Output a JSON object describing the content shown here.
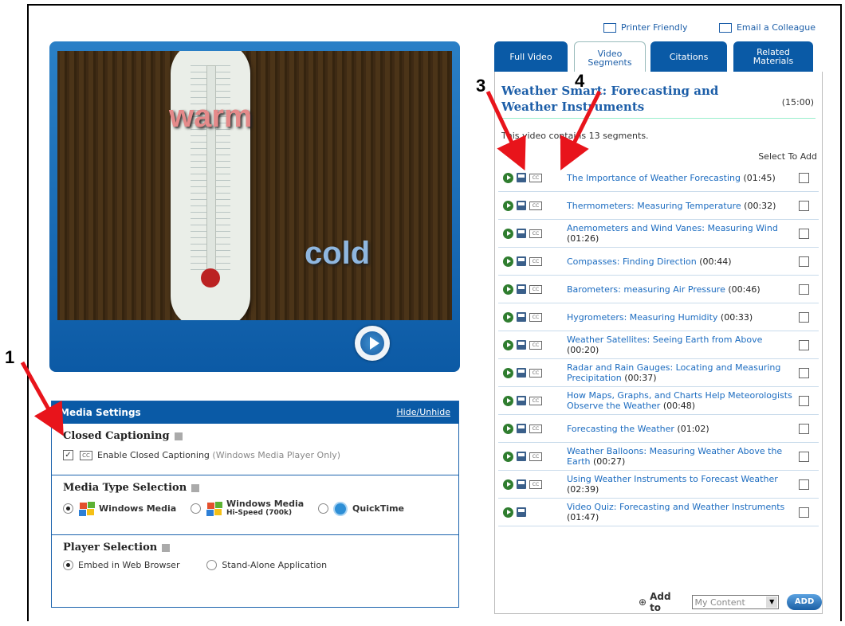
{
  "top_links": {
    "printer": "Printer Friendly",
    "email": "Email a Colleague"
  },
  "video_words": {
    "warm": "warm",
    "cold": "cold"
  },
  "media_settings": {
    "title": "Media Settings",
    "hide_link": "Hide/Unhide",
    "closed_captioning": {
      "title": "Closed Captioning",
      "option": "Enable Closed Captioning",
      "note": "(Windows Media Player Only)",
      "checked": true
    },
    "media_type": {
      "title": "Media Type Selection",
      "options": [
        {
          "label": "Windows Media",
          "selected": true
        },
        {
          "label": "Windows Media",
          "sub": "Hi-Speed (700k)",
          "selected": false
        },
        {
          "label": "QuickTime",
          "selected": false
        }
      ]
    },
    "player": {
      "title": "Player Selection",
      "options": [
        {
          "label": "Embed in Web Browser",
          "selected": true
        },
        {
          "label": "Stand-Alone Application",
          "selected": false
        }
      ]
    }
  },
  "tabs": [
    {
      "label": "Full Video",
      "active": false
    },
    {
      "label": "Video Segments",
      "active": true
    },
    {
      "label": "Citations",
      "active": false
    },
    {
      "label": "Related Materials",
      "active": false
    }
  ],
  "panel": {
    "title": "Weather Smart: Forecasting and Weather Instruments",
    "duration": "(15:00)",
    "info": "This video contains 13 segments.",
    "select_to_add": "Select To Add"
  },
  "segments": [
    {
      "title": "The Importance of Weather Forecasting",
      "time": "(01:45)"
    },
    {
      "title": "Thermometers: Measuring Temperature",
      "time": "(00:32)"
    },
    {
      "title": "Anemometers and Wind Vanes: Measuring Wind",
      "time": "(01:26)"
    },
    {
      "title": "Compasses: Finding Direction",
      "time": "(00:44)"
    },
    {
      "title": "Barometers: measuring Air Pressure",
      "time": "(00:46)"
    },
    {
      "title": "Hygrometers: Measuring Humidity",
      "time": "(00:33)"
    },
    {
      "title": "Weather Satellites: Seeing Earth from Above",
      "time": "(00:20)"
    },
    {
      "title": "Radar and Rain Gauges: Locating and Measuring Precipitation",
      "time": "(00:37)"
    },
    {
      "title": "How Maps, Graphs, and Charts Help Meteorologists Observe the Weather",
      "time": "(00:48)"
    },
    {
      "title": "Forecasting the Weather",
      "time": "(01:02)"
    },
    {
      "title": "Weather Balloons: Measuring Weather Above the Earth",
      "time": "(00:27)"
    },
    {
      "title": "Using Weather Instruments to Forecast Weather",
      "time": "(02:39)"
    },
    {
      "title": "Video Quiz: Forecasting and Weather Instruments",
      "time": "(01:47)",
      "no_cc": true
    }
  ],
  "add_bar": {
    "label": "Add to",
    "select_value": "My Content",
    "button": "ADD"
  },
  "annotations": {
    "n1": "1",
    "n3": "3",
    "n4": "4"
  },
  "colors": {
    "accent": "#0a5aa6",
    "link": "#1c6cc0",
    "arrow": "#e8141b"
  }
}
